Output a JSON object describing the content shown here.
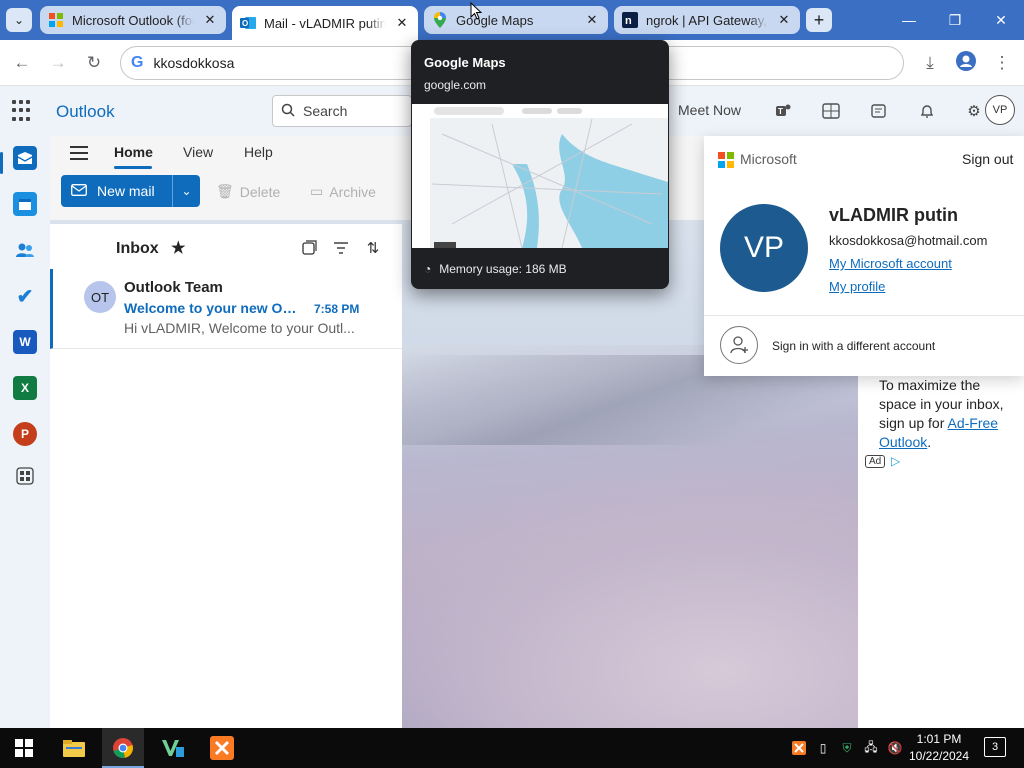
{
  "browser": {
    "tabs": [
      {
        "title": "Microsoft Outlook (for...",
        "icon": "microsoft-icon",
        "active": false
      },
      {
        "title": "Mail - vLADMIR putin -",
        "icon": "outlook-icon",
        "active": true
      },
      {
        "title": "Google Maps",
        "icon": "google-maps-icon",
        "active": false
      },
      {
        "title": "ngrok | API Gateway, I",
        "icon": "ngrok-icon",
        "active": false
      }
    ],
    "address": "kkosdokkosa",
    "hover_card": {
      "title": "Google Maps",
      "url": "google.com",
      "memory": "Memory usage: 186 MB"
    }
  },
  "outlook": {
    "brand": "Outlook",
    "search_label": "Search",
    "meet_now": "Meet Now",
    "avatar_initials": "VP",
    "ribbon": {
      "tabs": [
        "Home",
        "View",
        "Help"
      ],
      "new_mail": "New mail",
      "delete": "Delete",
      "archive": "Archive"
    },
    "folder": "Inbox",
    "messages": [
      {
        "avatar": "OT",
        "from": "Outlook Team",
        "subject": "Welcome to your new Ou...",
        "time": "7:58 PM",
        "preview": "Hi vLADMIR, Welcome to your Outl..."
      }
    ],
    "ad": {
      "text": "To maximize the space in your inbox, sign up for",
      "link": "Ad-Free Outlook",
      "suffix": ".",
      "badge": "Ad"
    }
  },
  "account_card": {
    "company": "Microsoft",
    "sign_out": "Sign out",
    "initials": "VP",
    "name": "vLADMIR putin",
    "email": "kkosdokkosa@hotmail.com",
    "links": [
      "My Microsoft account",
      "My profile"
    ],
    "sign_in_other": "Sign in with a different account"
  },
  "taskbar": {
    "time": "1:01 PM",
    "date": "10/22/2024",
    "notifications": "3"
  },
  "colors": {
    "accent": "#0f6cbd",
    "tabstrip": "#3b6fc4",
    "avatar_bg": "#1c5a8f"
  }
}
